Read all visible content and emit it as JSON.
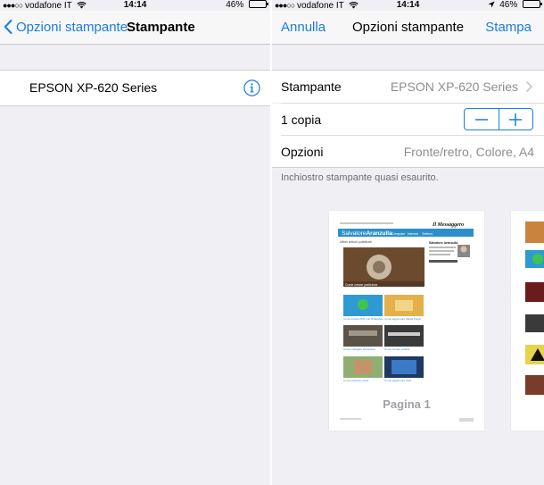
{
  "left": {
    "status": {
      "carrier": "vodafone IT",
      "time": "14:14",
      "battery": "46%",
      "battery_level": 0.46
    },
    "nav": {
      "back_label": "Opzioni stampante",
      "title": "Stampante"
    },
    "printer": {
      "name": "EPSON XP-620 Series"
    }
  },
  "right": {
    "status": {
      "carrier": "vodafone IT",
      "time": "14:14",
      "battery": "46%",
      "battery_level": 0.46
    },
    "nav": {
      "cancel": "Annulla",
      "title": "Opzioni stampante",
      "print": "Stampa"
    },
    "rows": {
      "printer_label": "Stampante",
      "printer_value": "EPSON XP-620 Series",
      "copies_label": "1 copia",
      "options_label": "Opzioni",
      "options_value": "Fronte/retro, Colore, A4"
    },
    "footnote": "Inchiostro stampante quasi esaurito.",
    "preview": {
      "page_label": "Pagina 1",
      "thumb": {
        "brand_left": "Salvatore",
        "brand_right": "Aranzulla",
        "masthead": "Il Messaggero",
        "section": "Ultimi articoli pubblicati",
        "nav": [
          "Computer",
          "Internet",
          "Telefoni"
        ],
        "author": "Salvatore Aranzulla",
        "feature_caption": "Come creare partizione",
        "tiles": [
          "Come inviare PDF con WhatsApp",
          "Come aggiornare Media Player",
          "Come collegare stampante",
          "Come trovare politica",
          "Come costruire asset",
          "Come aggiornare iPad"
        ]
      }
    }
  },
  "colors": {
    "accent": "#1a7de3",
    "background": "#efeff4",
    "cell": "#ffffff",
    "secondary_text": "#8e8e93"
  },
  "icons": [
    "back-chevron-icon",
    "info-icon",
    "disclosure-chevron-icon",
    "minus-icon",
    "plus-icon",
    "wifi-icon",
    "location-icon",
    "battery-icon"
  ]
}
